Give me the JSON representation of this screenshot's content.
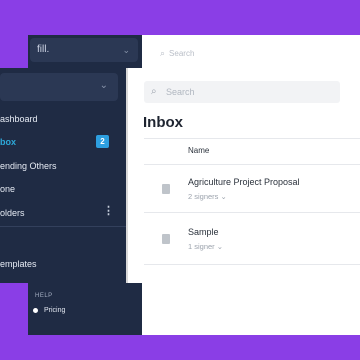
{
  "back": {
    "brand": "fill.",
    "search_placeholder": "Search",
    "column_letter": "P",
    "help_label": "HELP",
    "pricing_label": "Pricing"
  },
  "front": {
    "search_placeholder": "Search",
    "page_title": "Inbox",
    "column_name": "Name",
    "nav": [
      {
        "label": "ashboard"
      },
      {
        "label": "box",
        "badge": "2"
      },
      {
        "label": "ending Others"
      },
      {
        "label": "one"
      },
      {
        "label": "olders"
      },
      {
        "label": "emplates"
      }
    ],
    "documents": [
      {
        "title": "Agriculture Project Proposal",
        "subtitle": "2 signers"
      },
      {
        "title": "Sample",
        "subtitle": "1 signer"
      }
    ]
  },
  "icons": {
    "search": "search-icon",
    "chevron": "chevron-down-icon",
    "doc": "document-icon",
    "kebab": "more-vertical-icon"
  },
  "colors": {
    "background": "#8a3ee6",
    "sidebar": "#1f2b44",
    "accent": "#2da8d8",
    "badge": "#2d9fe0"
  }
}
